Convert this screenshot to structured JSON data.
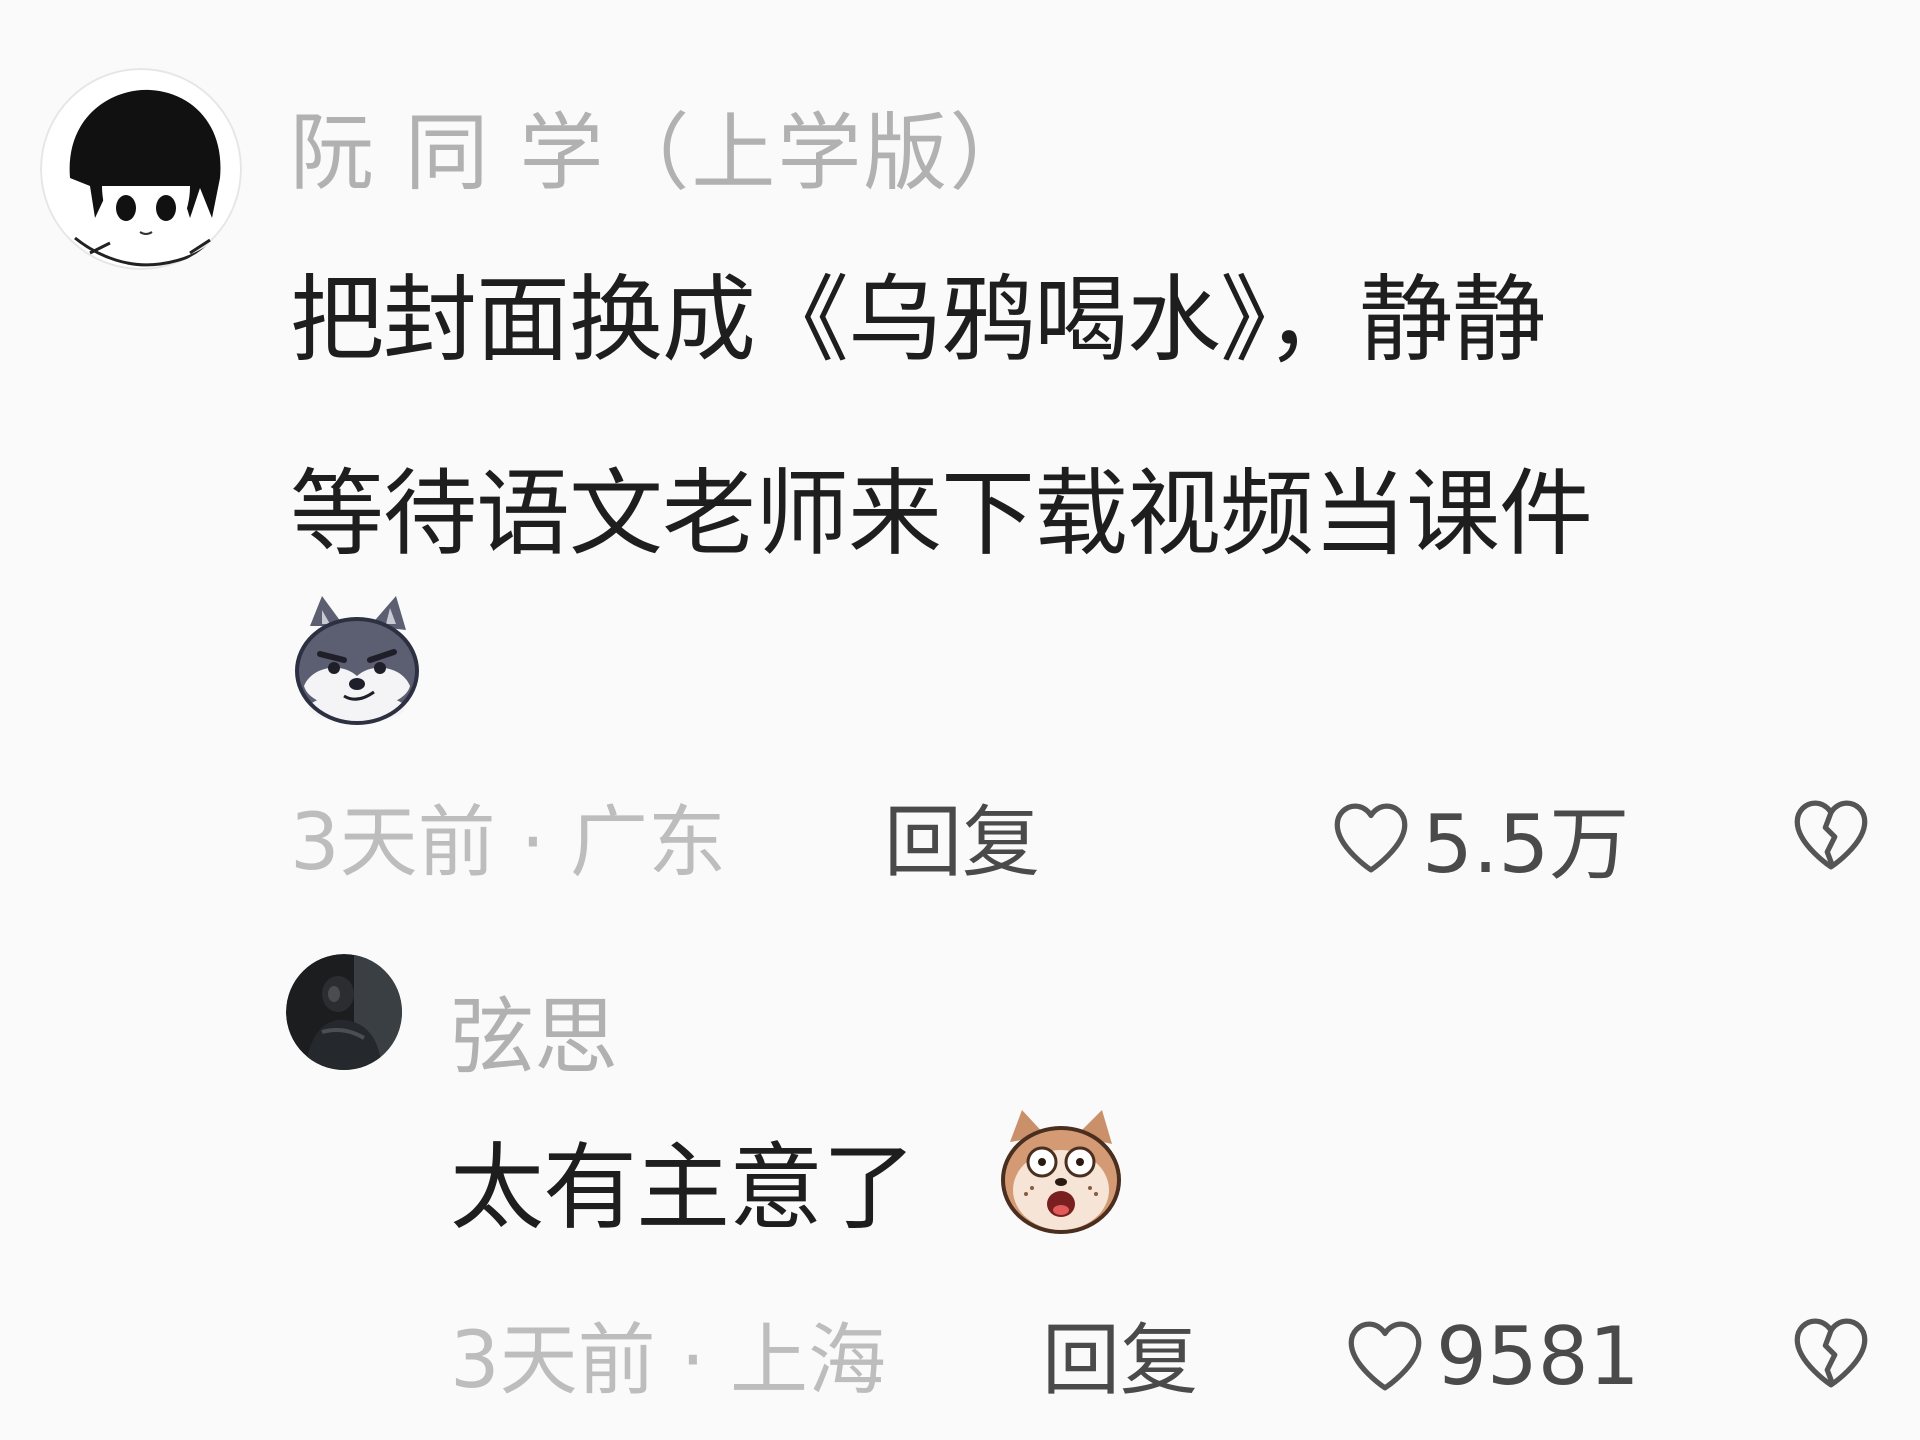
{
  "comments": [
    {
      "username": "阮 同 学（上学版）",
      "text_line1": "把封面换成《乌鸦喝水》，静静",
      "text_line2": "等待语文老师来下载视频当课件",
      "emoji": "husky-smirk-emoji",
      "time": "3天前",
      "sep": "·",
      "location": "广东",
      "reply_label": "回复",
      "like_count": "5.5万"
    },
    {
      "username": "弦思",
      "text": "太有主意了",
      "emoji": "dog-shocked-emoji",
      "time": "3天前",
      "sep": "·",
      "location": "上海",
      "reply_label": "回复",
      "like_count": "9581"
    }
  ],
  "icons": {
    "like": "heart-outline-icon",
    "dislike": "broken-heart-icon"
  },
  "colors": {
    "background": "#fafafa",
    "username": "#b1b1b1",
    "text": "#1e1e1e",
    "meta": "#bdbdbd",
    "action": "#4a4a4a"
  }
}
